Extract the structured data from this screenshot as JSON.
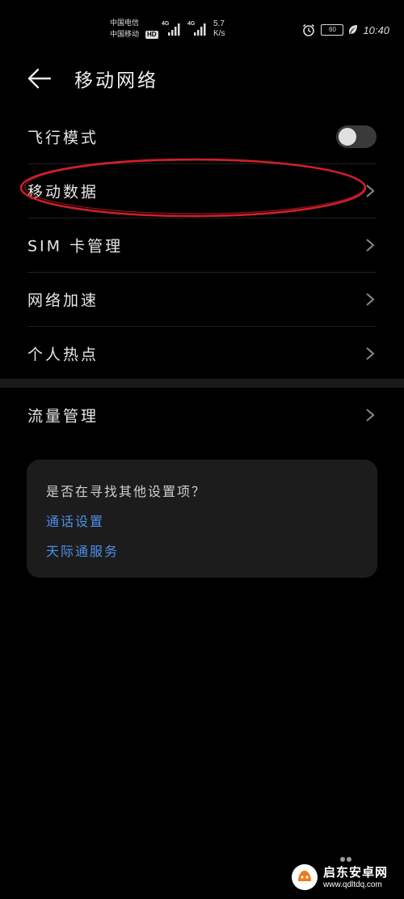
{
  "status_bar": {
    "carrier_1": "中国电信",
    "carrier_2": "中国移动",
    "hd_badge": "HD",
    "net_1": "4G",
    "net_2": "4G",
    "speed_value": "5.7",
    "speed_unit": "K/s",
    "battery_level": "60",
    "time": "10:40"
  },
  "header": {
    "title": "移动网络",
    "back_icon": "arrow-left-icon"
  },
  "list": {
    "items": [
      {
        "label": "飞行模式",
        "control": "toggle",
        "toggle_on": false
      },
      {
        "label": "移动数据",
        "control": "chevron"
      },
      {
        "label": "SIM 卡管理",
        "control": "chevron"
      },
      {
        "label": "网络加速",
        "control": "chevron"
      },
      {
        "label": "个人热点",
        "control": "chevron"
      }
    ]
  },
  "list2": {
    "items": [
      {
        "label": "流量管理",
        "control": "chevron"
      }
    ]
  },
  "card": {
    "title": "是否在寻找其他设置项？",
    "links": [
      "通话设置",
      "天际通服务"
    ]
  },
  "watermark": {
    "name": "启东安卓网",
    "url": "www.qdltdq.com"
  },
  "colors": {
    "background": "#000000",
    "link": "#4c8fe8",
    "highlight": "#d0202a",
    "card": "#1c1c1c"
  }
}
